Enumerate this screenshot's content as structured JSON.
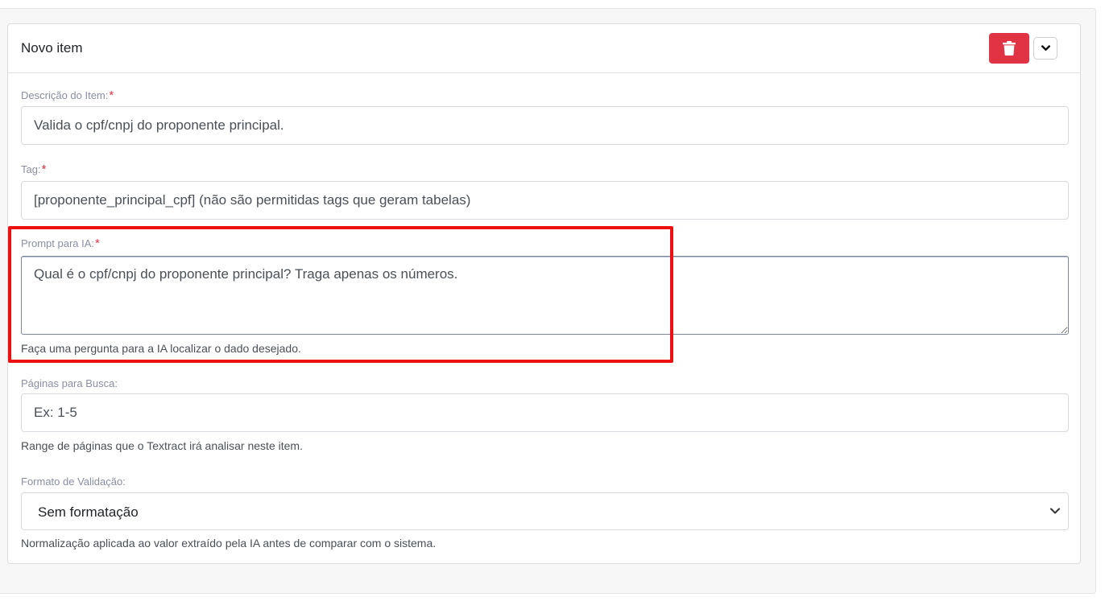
{
  "card": {
    "title": "Novo item",
    "delete_icon": "trash-icon",
    "toggle_icon": "chevron-down-icon"
  },
  "fields": {
    "descricao": {
      "label": "Descrição do Item:",
      "required": "*",
      "value": "Valida o cpf/cnpj do proponente principal."
    },
    "tag": {
      "label": "Tag:",
      "required": "*",
      "value": "[proponente_principal_cpf] (não são permitidas tags que geram tabelas)"
    },
    "prompt": {
      "label": "Prompt para IA:",
      "required": "*",
      "value": "Qual é o cpf/cnpj do proponente principal? Traga apenas os números.",
      "help": "Faça uma pergunta para a IA localizar o dado desejado."
    },
    "paginas": {
      "label": "Páginas para Busca:",
      "placeholder": "Ex: 1-5",
      "help": "Range de páginas que o Textract irá analisar neste item."
    },
    "formato": {
      "label": "Formato de Validação:",
      "selected": "Sem formatação",
      "help": "Normalização aplicada ao valor extraído pela IA antes de comparar com o sistema."
    }
  },
  "colors": {
    "danger": "#e03444",
    "highlight": "#ec1111"
  }
}
